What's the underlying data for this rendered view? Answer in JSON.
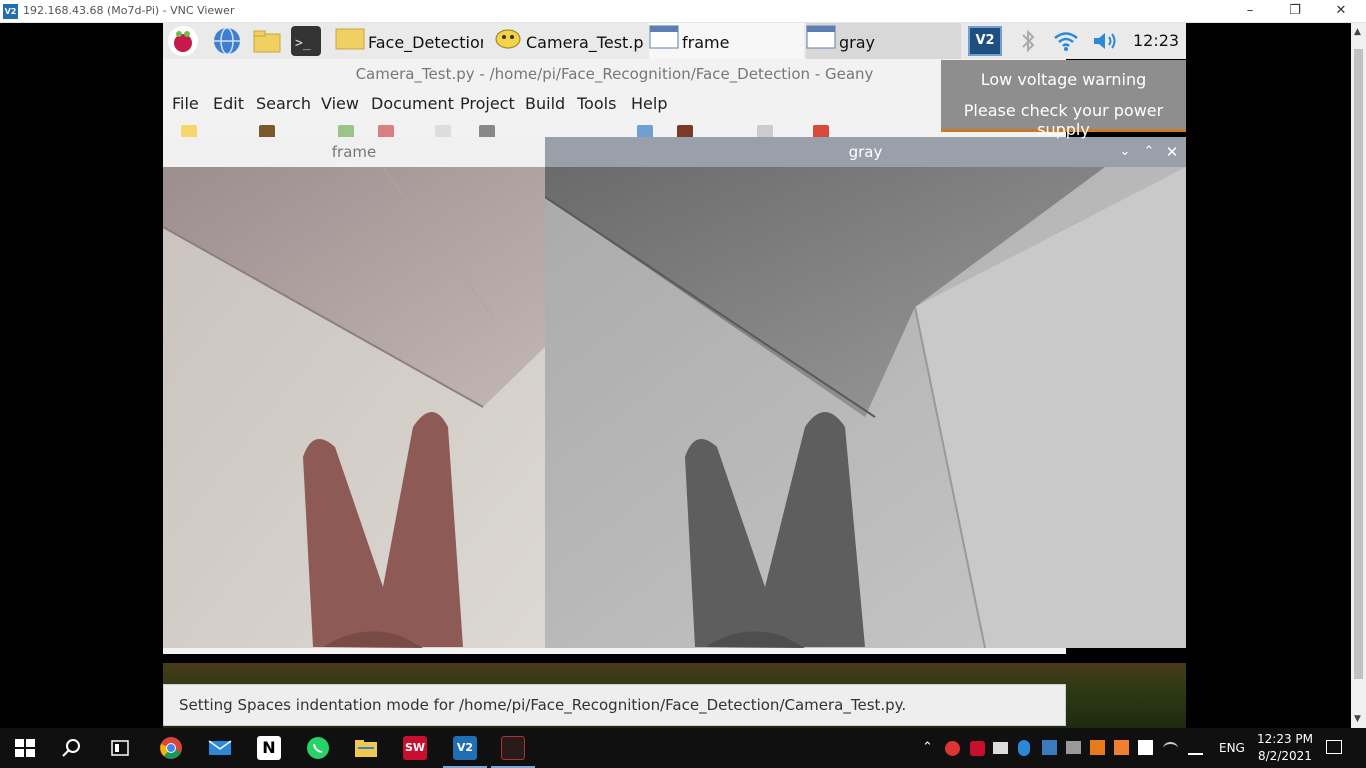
{
  "vnc": {
    "logo_text": "V2",
    "title": "192.168.43.68 (Mo7d-Pi) - VNC Viewer",
    "minimize_icon": "minimize-icon",
    "restore_icon": "restore-icon",
    "close_icon": "close-icon"
  },
  "panel": {
    "tasks": [
      {
        "label": "Face_Detection",
        "icon": "folder-icon"
      },
      {
        "label": "Camera_Test.p...",
        "icon": "geany-icon"
      },
      {
        "label": "frame",
        "icon": "window-icon"
      },
      {
        "label": "gray",
        "icon": "window-icon"
      }
    ],
    "clock": "12:23"
  },
  "geany": {
    "title": "Camera_Test.py - /home/pi/Face_Recognition/Face_Detection - Geany",
    "menus": [
      "File",
      "Edit",
      "Search",
      "View",
      "Document",
      "Project",
      "Build",
      "Tools",
      "Help"
    ],
    "status": "Setting Spaces indentation mode for /home/pi/Face_Recognition/Face_Detection/Camera_Test.py."
  },
  "notification": {
    "line1": "Low voltage warning",
    "line2": "Please check your power supply"
  },
  "windows": {
    "frame_title": "frame",
    "gray_title": "gray"
  },
  "taskbar": {
    "language": "ENG",
    "time": "12:23 PM",
    "date": "8/2/2021"
  },
  "colors": {
    "accent": "#1f6fb2",
    "warning_border": "#c87c2a"
  }
}
